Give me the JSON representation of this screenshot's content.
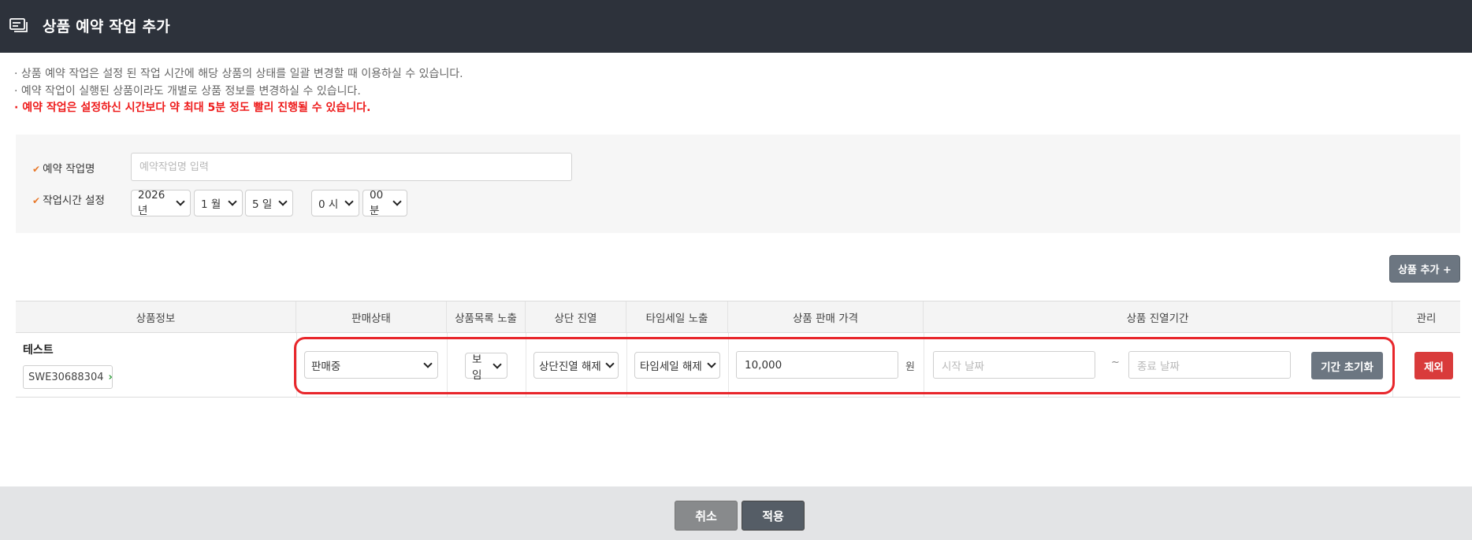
{
  "header": {
    "title": "상품 예약 작업 추가",
    "icon": "window-icon"
  },
  "notes": [
    "· 상품 예약 작업은 설정 된 작업 시간에 해당 상품의 상태를 일괄 변경할 때 이용하실 수 있습니다.",
    "· 예약 작업이 실행된 상품이라도 개별로 상품 정보를 변경하실 수 있습니다.",
    "· 예약 작업은 설정하신 시간보다 약 최대 5분 정도 빨리 진행될 수 있습니다."
  ],
  "form": {
    "name_label": "예약 작업명",
    "name_placeholder": "예약작업명 입력",
    "time_label": "작업시간 설정",
    "year": "2026 년",
    "month": "1 월",
    "day": "5 일",
    "hour": "0 시",
    "minute": "00분",
    "check_mark": "✔"
  },
  "add_button": "상품 추가 +",
  "table": {
    "headers": [
      "상품정보",
      "판매상태",
      "상품목록 노출",
      "상단 진열",
      "타임세일 노출",
      "상품 판매 가격",
      "상품 진열기간",
      "관리"
    ],
    "row": {
      "product_name": "테스트",
      "product_code": "SWE30688304",
      "code_arrow": "›",
      "sale_status": "판매중",
      "list_exposure": "보임",
      "top_display": "상단진열 해제",
      "timesale": "타임세일 해제",
      "price": "10,000",
      "price_unit": "원",
      "start_placeholder": "시작 날짜",
      "tilde": "~",
      "end_placeholder": "종료 날짜",
      "reset_button": "기간 초기화",
      "delete_button": "제외"
    }
  },
  "footer": {
    "cancel": "취소",
    "apply": "적용"
  },
  "colors": {
    "header_bg": "#2d323b",
    "accent_red": "#ee1b1b",
    "delete_red": "#d93b3b",
    "button_gray": "#6c7681",
    "check_orange": "#e8792b"
  }
}
